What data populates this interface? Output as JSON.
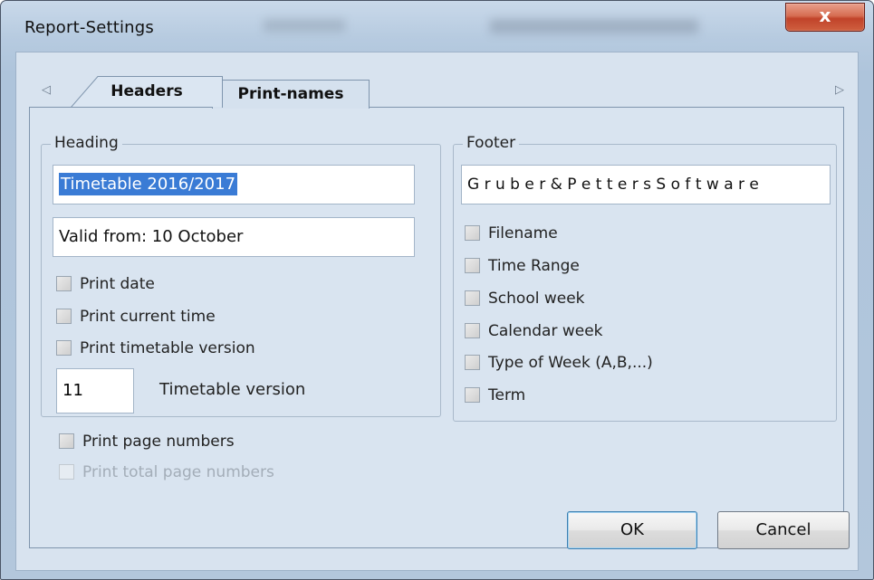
{
  "window": {
    "title": "Report-Settings",
    "close_glyph": "x"
  },
  "tabs": {
    "left_arrow": "◁",
    "right_arrow": "▷",
    "items": [
      {
        "label": "Headers",
        "active": true
      },
      {
        "label": "Print-names",
        "active": false
      }
    ]
  },
  "heading": {
    "legend": "Heading",
    "line1": "Timetable 2016/2017",
    "line2": "Valid from: 10 October",
    "print_date": "Print date",
    "print_current_time": "Print current time",
    "print_timetable_version": "Print timetable version",
    "version_value": "11",
    "version_label": "Timetable version"
  },
  "page_numbers": {
    "print_page_numbers": "Print page numbers",
    "print_total_page_numbers": "Print total page numbers"
  },
  "footer": {
    "legend": "Footer",
    "text": "G r u b e r  &  P e t t e r s  S o f t w a r e",
    "options": [
      "Filename",
      "Time Range",
      "School week",
      "Calendar week",
      "Type of Week (A,B,...)",
      "Term"
    ]
  },
  "buttons": {
    "ok": "OK",
    "cancel": "Cancel"
  },
  "colors": {
    "selection": "#3a7bd5",
    "close_button": "#c1432a",
    "panel": "#d9e4f0"
  }
}
